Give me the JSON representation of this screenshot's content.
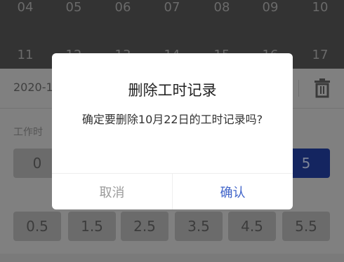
{
  "calendar": {
    "week1": [
      "04",
      "05",
      "06",
      "07",
      "08",
      "09",
      "10"
    ],
    "week2": [
      "11",
      "12",
      "13",
      "14",
      "15",
      "16",
      "17"
    ]
  },
  "record": {
    "date": "2020-1",
    "work_label": "工作时",
    "trash_icon": "trash-icon"
  },
  "hours": {
    "row1": [
      "0",
      "",
      "",
      "",
      "",
      "",
      "5"
    ],
    "row2": [
      "0.5",
      "1.5",
      "2.5",
      "3.5",
      "4.5",
      "5.5"
    ],
    "selected": "5"
  },
  "dialog": {
    "title": "删除工时记录",
    "message": "确定要删除10月22日的工时记录吗?",
    "cancel": "取消",
    "confirm": "确认"
  },
  "colors": {
    "accent": "#3f63c9",
    "selected_button": "#1d3fb1"
  }
}
